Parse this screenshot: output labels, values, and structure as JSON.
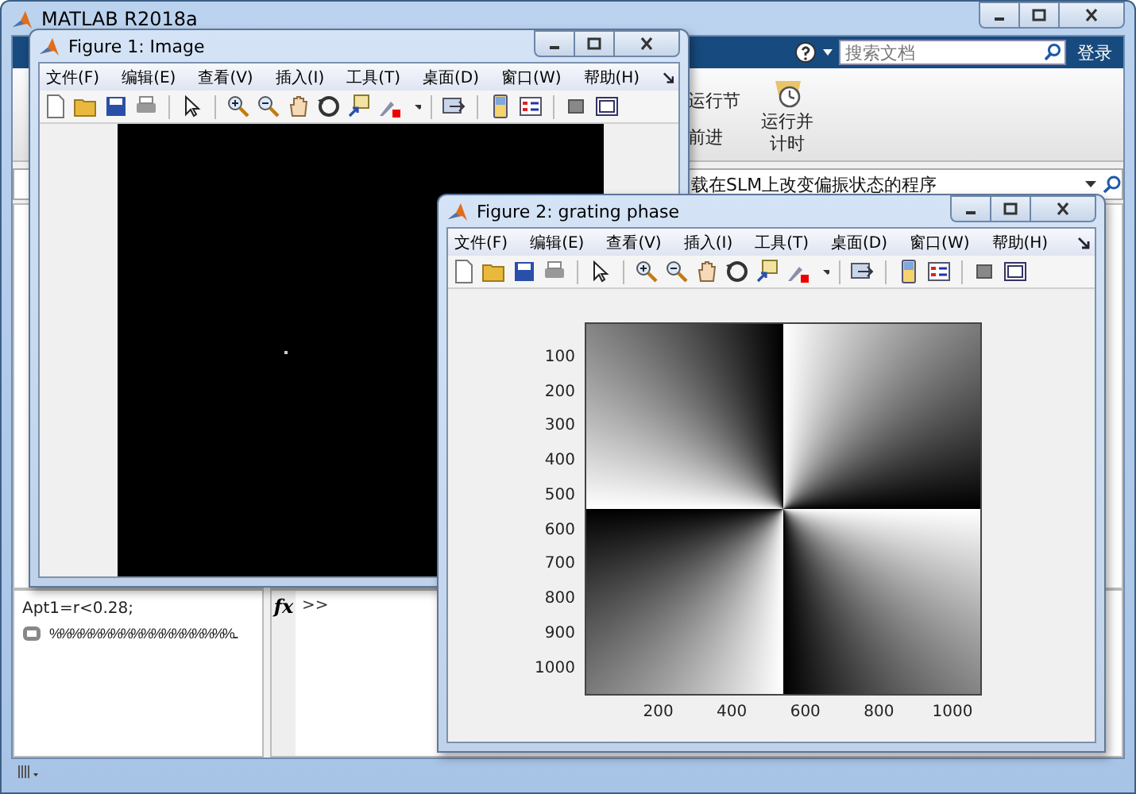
{
  "main_window": {
    "title": "MATLAB R2018a",
    "search": {
      "placeholder": "搜索文档"
    },
    "login_button": "登录",
    "ribbon": [
      {
        "kind": "text",
        "label": "运行节"
      },
      {
        "kind": "text",
        "label": "前进"
      },
      {
        "kind": "icon_button",
        "label": "运行并计时"
      }
    ],
    "address": "载在SLM上改变偏振状态的程序",
    "history": [
      {
        "kind": "code",
        "text": "Apt1=r<0.28;"
      },
      {
        "kind": "section",
        "text": "%%%%%%%%%%%%%%%%%%..."
      }
    ],
    "command_window": {
      "function_icon": "fx",
      "prompt": ">>"
    }
  },
  "figures": [
    {
      "title": "Figure 1: Image",
      "kind": "image",
      "menu": [
        "文件(F)",
        "编辑(E)",
        "查看(V)",
        "插入(I)",
        "工具(T)",
        "桌面(D)",
        "窗口(W)",
        "帮助(H)"
      ]
    },
    {
      "title": "Figure 2: grating phase",
      "kind": "axes",
      "menu": [
        "文件(F)",
        "编辑(E)",
        "查看(V)",
        "插入(I)",
        "工具(T)",
        "桌面(D)",
        "窗口(W)",
        "帮助(H)"
      ],
      "yticks": [
        "100",
        "200",
        "300",
        "400",
        "500",
        "600",
        "700",
        "800",
        "900",
        "1000"
      ],
      "xticks": [
        "200",
        "400",
        "600",
        "800",
        "1000"
      ]
    }
  ]
}
